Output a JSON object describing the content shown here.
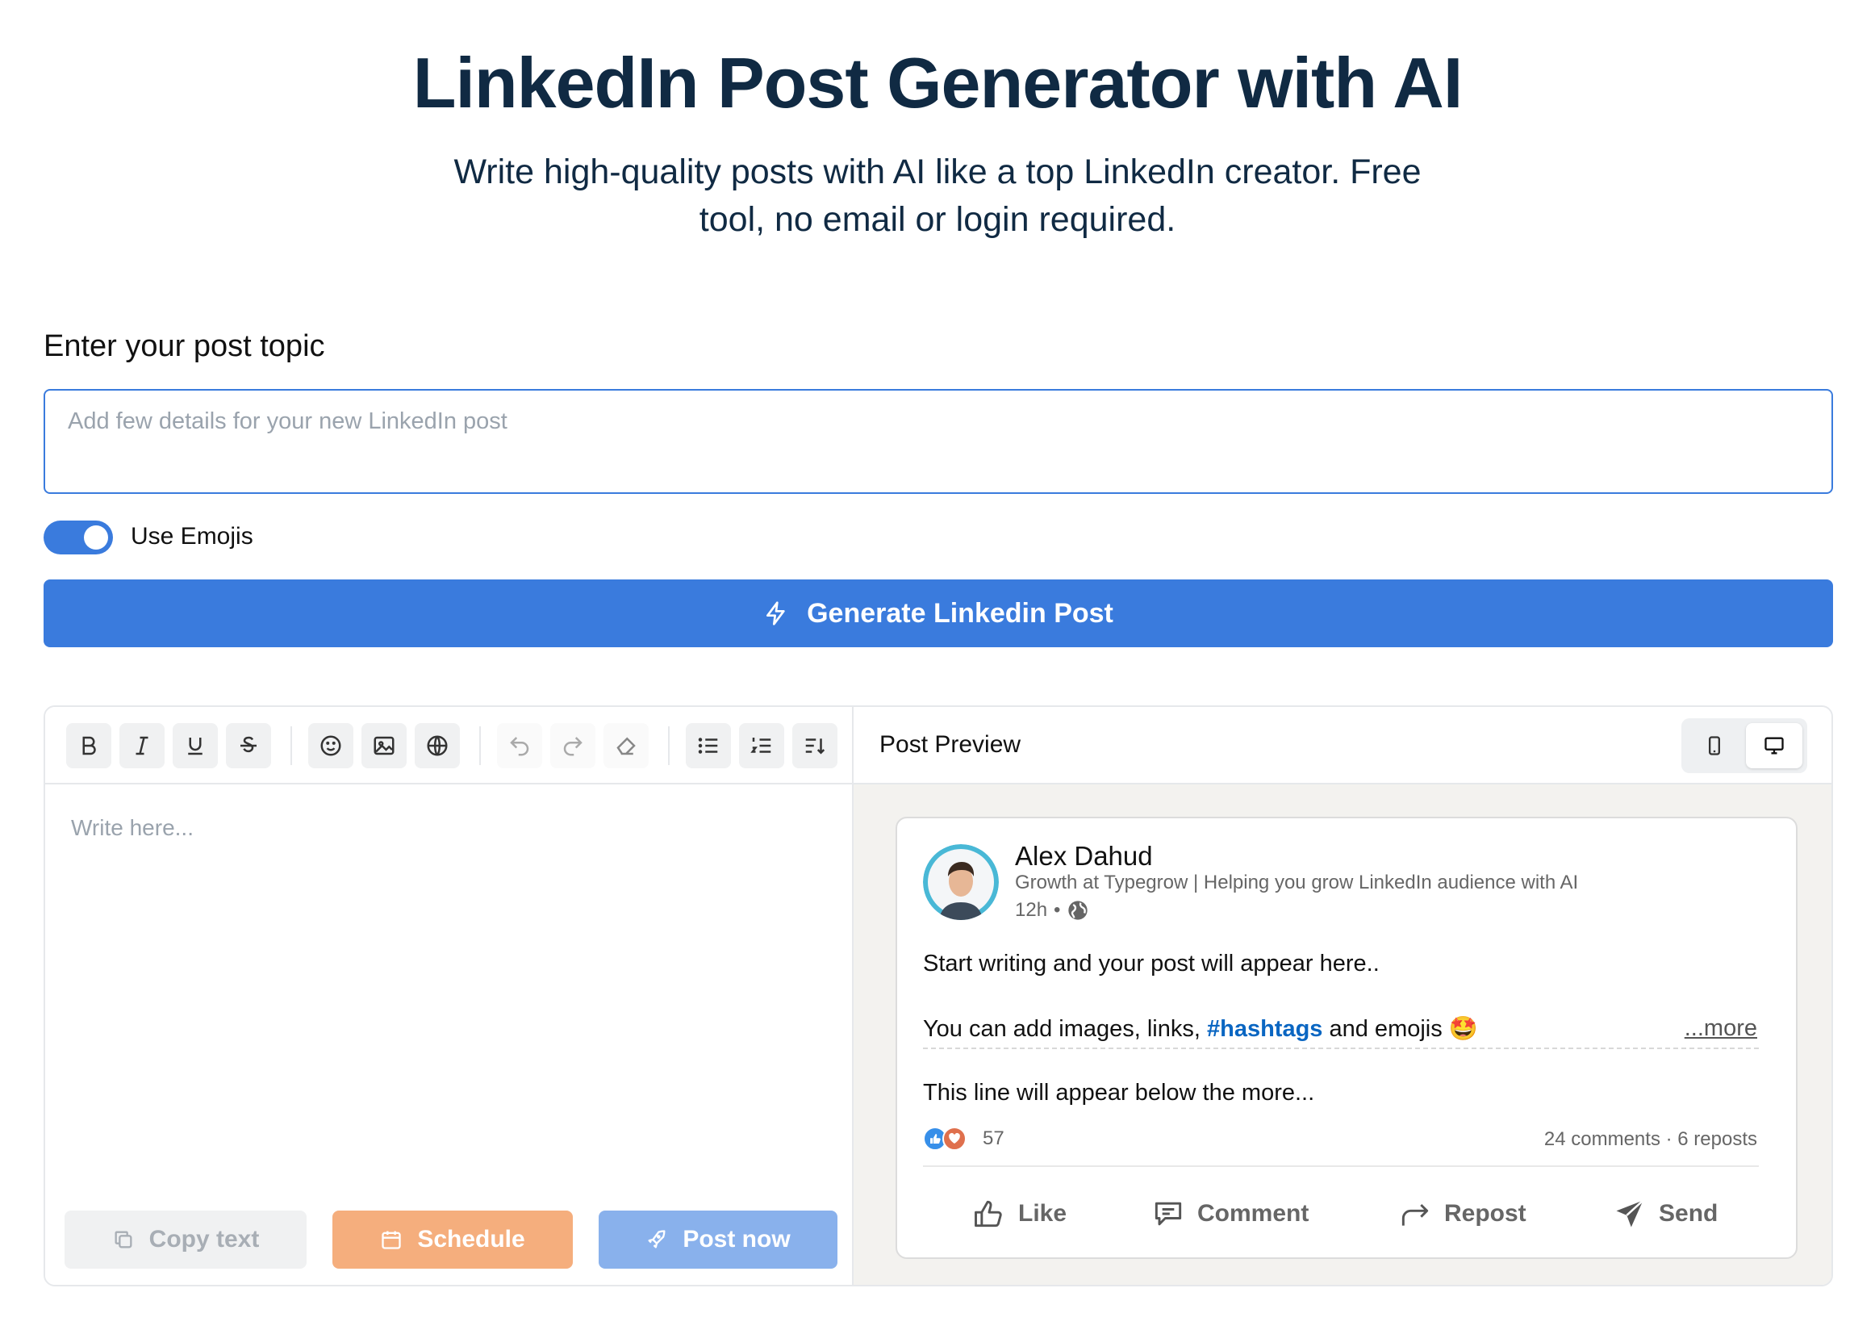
{
  "header": {
    "title": "LinkedIn Post Generator with AI",
    "subtitle": "Write high-quality posts with AI like a top LinkedIn creator. Free tool, no email or login required."
  },
  "form": {
    "topic_label": "Enter your post topic",
    "topic_placeholder": "Add few details for your new LinkedIn post",
    "topic_value": "",
    "emoji_toggle_label": "Use Emojis",
    "emoji_toggle_on": true,
    "generate_label": "Generate Linkedin Post"
  },
  "editor": {
    "toolbar": [
      "bold-icon",
      "italic-icon",
      "underline-icon",
      "strikethrough-icon",
      "emoji-icon",
      "image-icon",
      "globe-icon",
      "undo-icon",
      "redo-icon",
      "eraser-icon",
      "bullet-list-icon",
      "numbered-list-icon",
      "sort-icon"
    ],
    "placeholder": "Write here...",
    "copy_label": "Copy text",
    "schedule_label": "Schedule",
    "post_label": "Post now"
  },
  "preview": {
    "title": "Post Preview",
    "view_mode": "desktop",
    "author": "Alex Dahud",
    "headline": "Growth at Typegrow | Helping you grow LinkedIn audience with AI",
    "time": "12h",
    "dot": "•",
    "line1": "Start writing and your post will appear here..",
    "line2_prefix": "You can add images, links, ",
    "line2_tag": "#hashtags",
    "line2_suffix": " and emojis 🤩",
    "more": "...more",
    "line3": "This line will appear below the more...",
    "reaction_count": "57",
    "counts": "24 comments · 6 reposts",
    "actions": {
      "like": "Like",
      "comment": "Comment",
      "repost": "Repost",
      "send": "Send"
    }
  },
  "colors": {
    "primary": "#3a7bdd",
    "schedule": "#f5ae7d",
    "post_now": "#89b1ec",
    "hashtag": "#0a66c2",
    "title": "#102a43"
  }
}
